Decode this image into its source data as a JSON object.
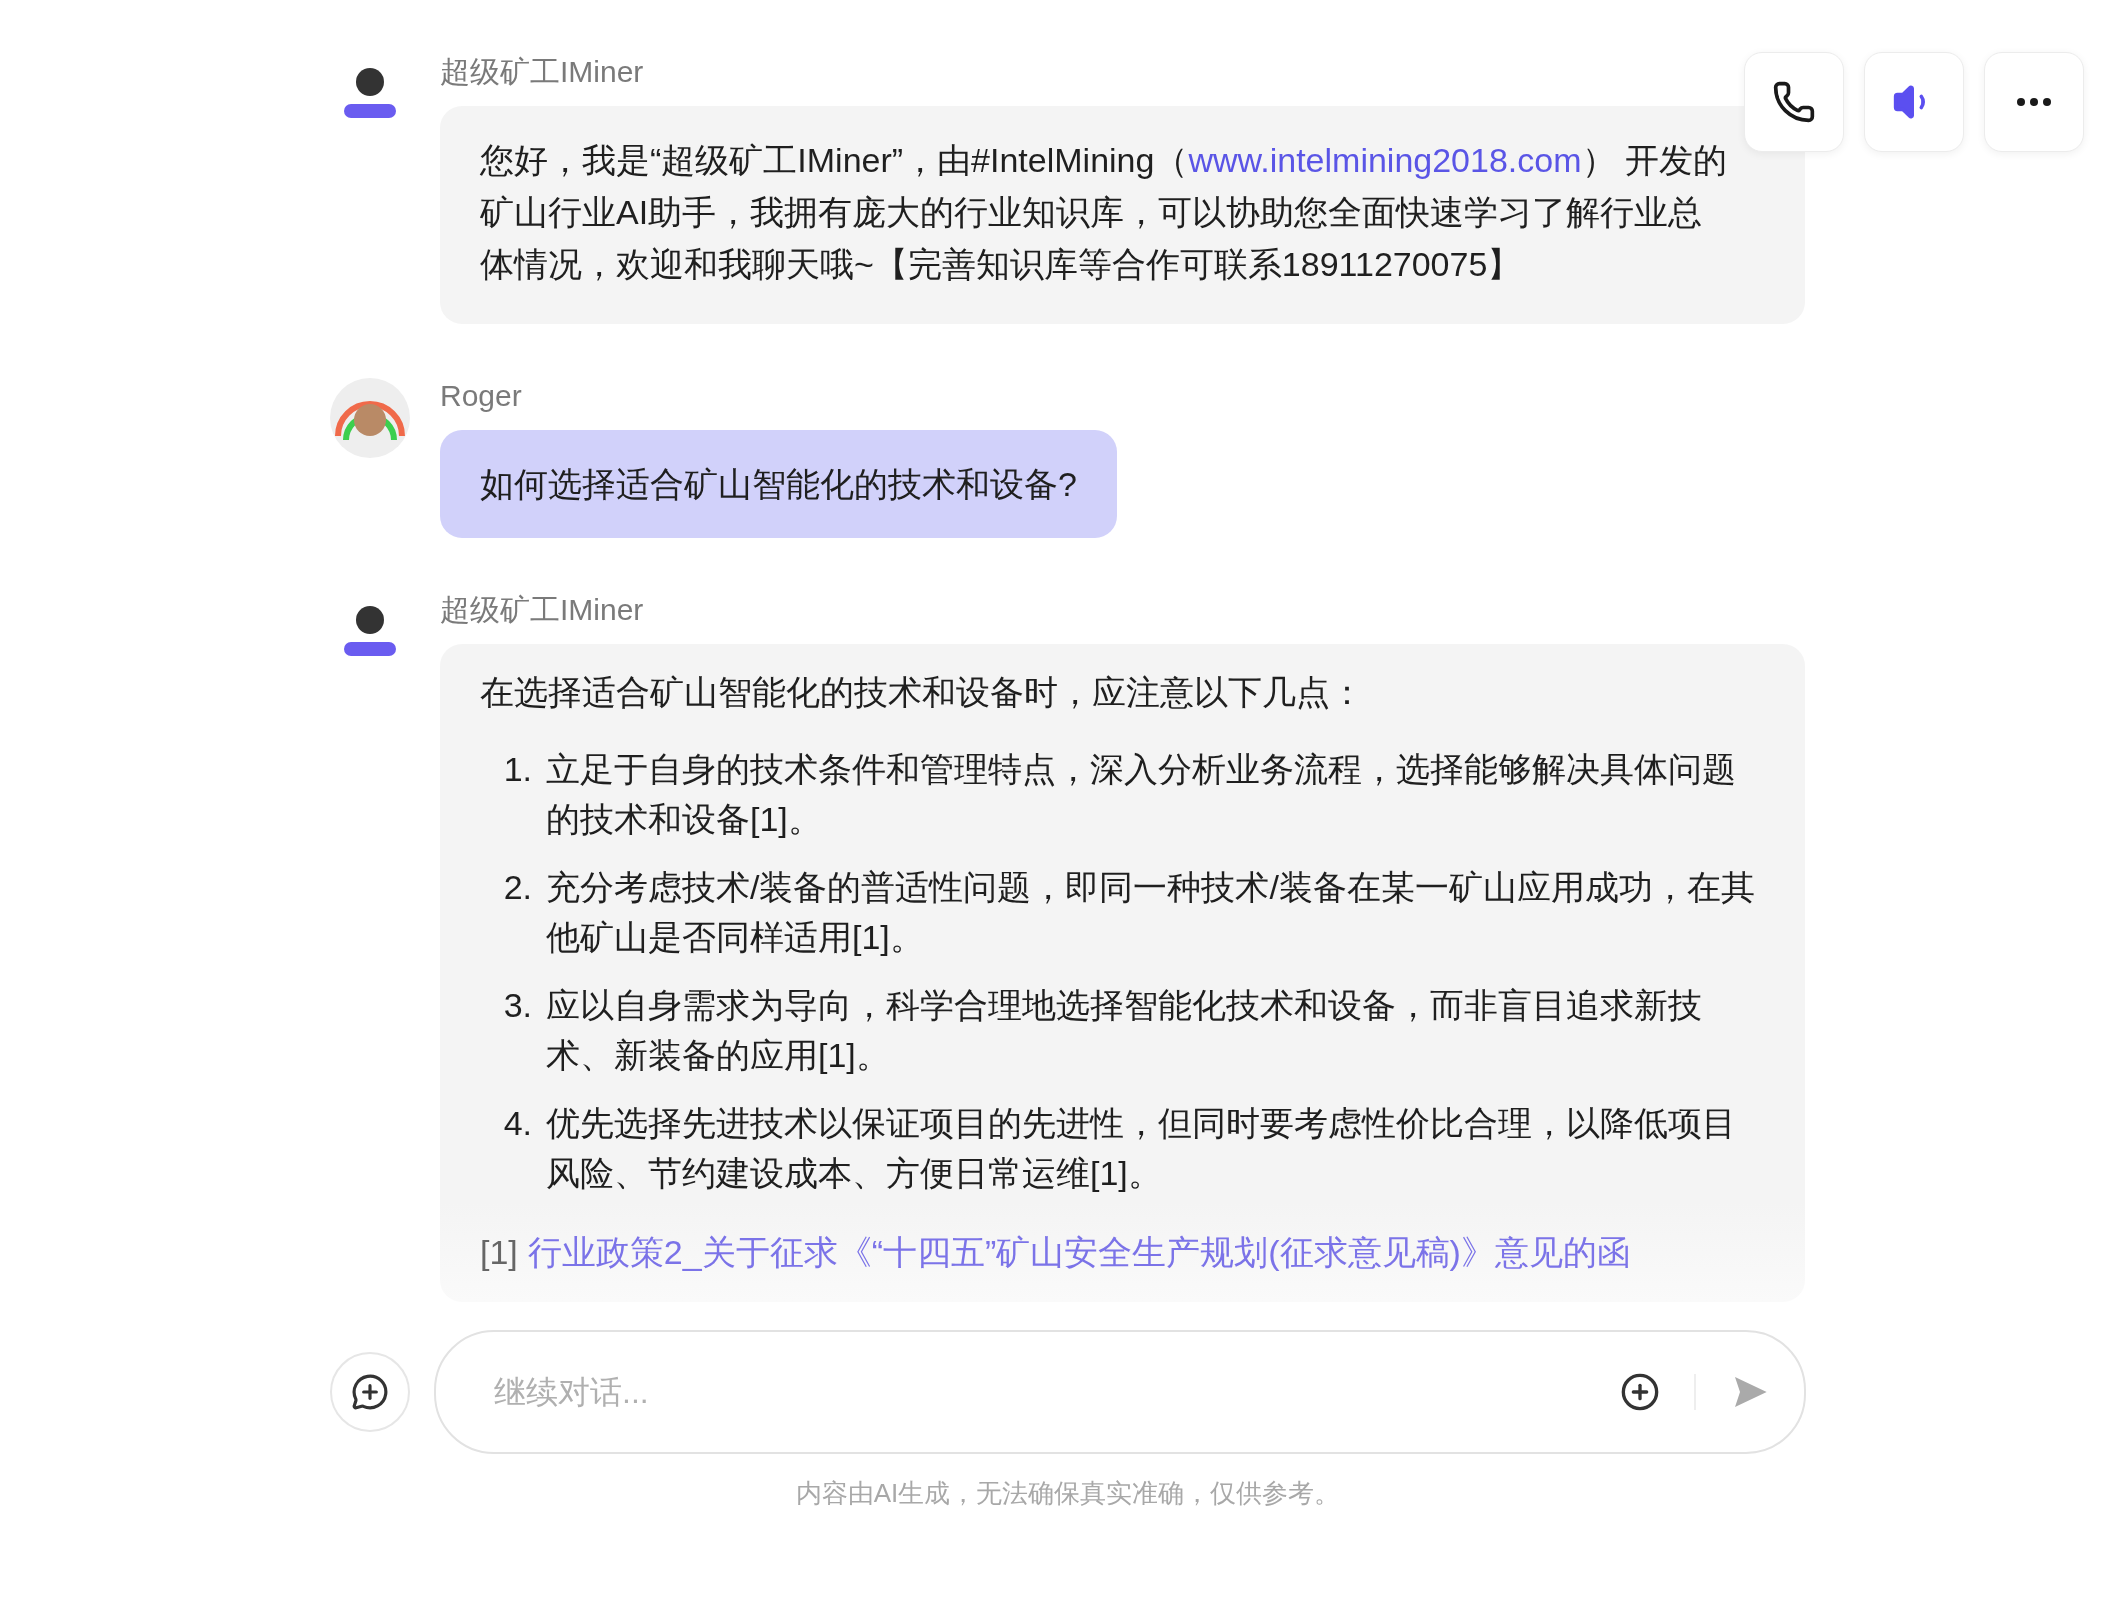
{
  "toolbar": [
    {
      "kind": "call",
      "active": false
    },
    {
      "kind": "speaker",
      "active": true
    },
    {
      "kind": "more",
      "active": false
    }
  ],
  "messages": [
    {
      "kind": "bot",
      "sender": "超级矿工IMiner",
      "segments": [
        {
          "kind": "text",
          "text": "您好，我是“超级矿工IMiner”，由#IntelMining（"
        },
        {
          "kind": "link",
          "text": "www.intelmining2018.com"
        },
        {
          "kind": "text",
          "text": "） 开发的矿山行业AI助手，我拥有庞大的行业知识库，可以协助您全面快速学习了解行业总体情况，欢迎和我聊天哦~【完善知识库等合作可联系18911270075】"
        }
      ]
    },
    {
      "kind": "user",
      "sender": "Roger",
      "segments": [
        {
          "kind": "text",
          "text": "如何选择适合矿山智能化的技术和设备?"
        }
      ]
    },
    {
      "kind": "bot",
      "sender": "超级矿工IMiner",
      "intro": "在选择适合矿山智能化的技术和设备时，应注意以下几点：",
      "list": [
        {
          "number": "1.",
          "text": "立足于自身的技术条件和管理特点，深入分析业务流程，选择能够解决具体问题的技术和设备[1]。"
        },
        {
          "number": "2.",
          "text": "充分考虑技术/装备的普适性问题，即同一种技术/装备在某一矿山应用成功，在其他矿山是否同样适用[1]。"
        },
        {
          "number": "3.",
          "text": "应以自身需求为导向，科学合理地选择智能化技术和设备，而非盲目追求新技术、新装备的应用[1]。"
        },
        {
          "number": "4.",
          "text": "优先选择先进技术以保证项目的先进性，但同时要考虑性价比合理，以降低项目风险、节约建设成本、方便日常运维[1]。"
        }
      ],
      "references": [
        {
          "marker": "[1]",
          "title": "行业政策2_关于征求《“十四五”矿山安全生产规划(征求意见稿)》意见的函"
        }
      ]
    }
  ],
  "composer": {
    "placeholder": "继续对话..."
  },
  "disclaimer": "内容由AI生成，无法确保真实准确，仅供参考。"
}
